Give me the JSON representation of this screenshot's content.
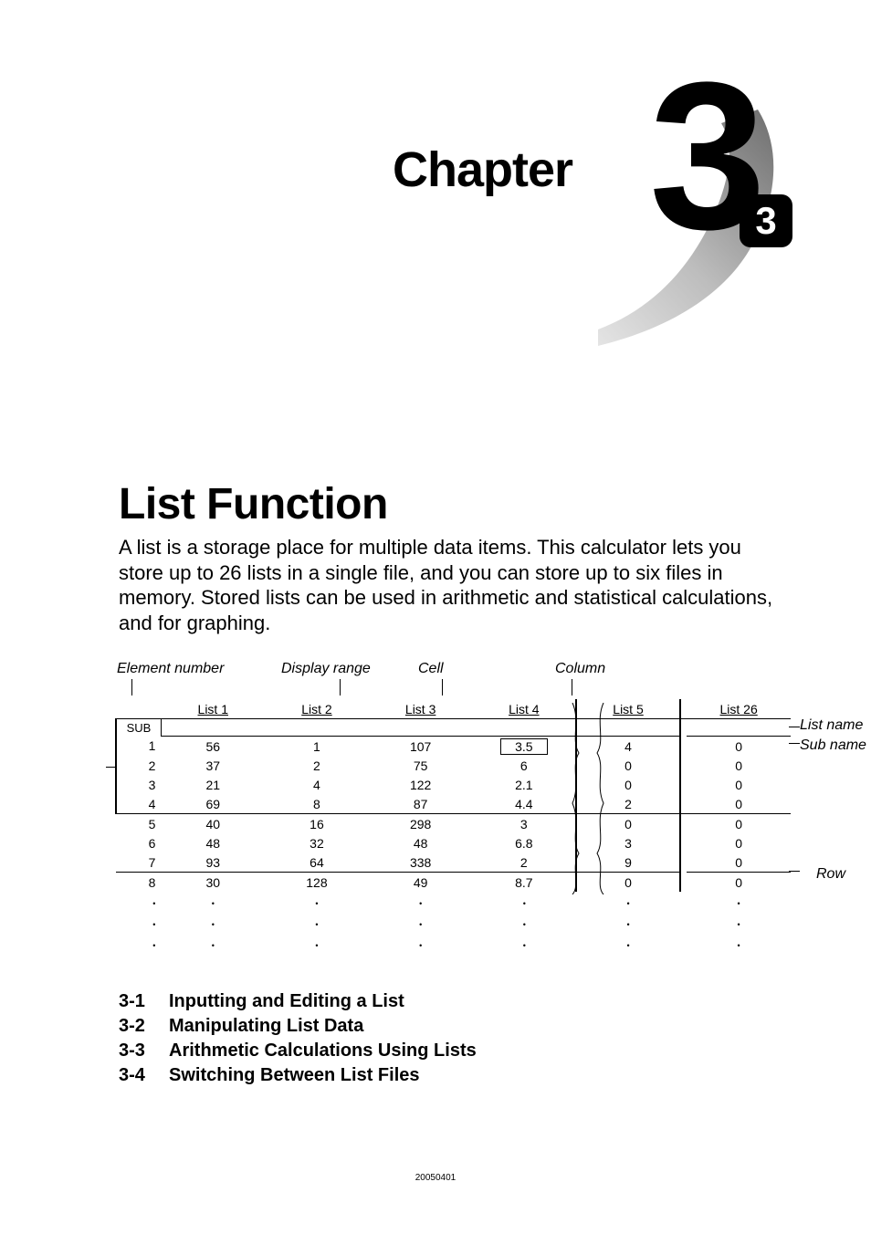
{
  "chapter": {
    "label": "Chapter",
    "number": "3",
    "badge": "3"
  },
  "title": "List Function",
  "intro": "A list is a storage place for multiple data items.\nThis calculator lets you store up to 26 lists in a single file, and you can store up to six files in memory.  Stored lists can be used in arithmetic and statistical calculations, and for graphing.",
  "diagram": {
    "top_labels": {
      "element_number": "Element number",
      "display_range": "Display range",
      "cell": "Cell",
      "column": "Column"
    },
    "right_labels": {
      "list_name": "List name",
      "sub_name": "Sub name",
      "row": "Row"
    },
    "columns": [
      "List  1",
      "List  2",
      "List  3",
      "List  4",
      "List  5",
      "List  26"
    ],
    "sub_label": "SUB",
    "rows": [
      {
        "n": "1",
        "v": [
          "56",
          "1",
          "107",
          "3.5",
          "4",
          "0"
        ]
      },
      {
        "n": "2",
        "v": [
          "37",
          "2",
          "75",
          "6",
          "0",
          "0"
        ]
      },
      {
        "n": "3",
        "v": [
          "21",
          "4",
          "122",
          "2.1",
          "0",
          "0"
        ]
      },
      {
        "n": "4",
        "v": [
          "69",
          "8",
          "87",
          "4.4",
          "2",
          "0"
        ]
      },
      {
        "n": "5",
        "v": [
          "40",
          "16",
          "298",
          "3",
          "0",
          "0"
        ]
      },
      {
        "n": "6",
        "v": [
          "48",
          "32",
          "48",
          "6.8",
          "3",
          "0"
        ]
      },
      {
        "n": "7",
        "v": [
          "93",
          "64",
          "338",
          "2",
          "9",
          "0"
        ]
      },
      {
        "n": "8",
        "v": [
          "30",
          "128",
          "49",
          "8.7",
          "0",
          "0"
        ]
      }
    ]
  },
  "toc": [
    {
      "num": "3-1",
      "title": "Inputting and Editing a List"
    },
    {
      "num": "3-2",
      "title": "Manipulating List Data"
    },
    {
      "num": "3-3",
      "title": "Arithmetic Calculations Using Lists"
    },
    {
      "num": "3-4",
      "title": "Switching Between List Files"
    }
  ],
  "footer": "20050401"
}
